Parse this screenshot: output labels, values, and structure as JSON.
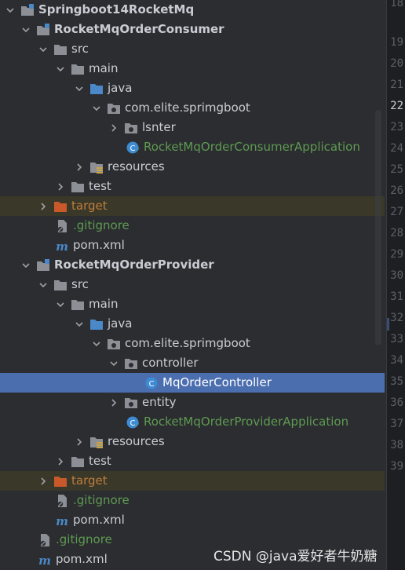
{
  "tree": {
    "items": [
      {
        "label": "Springboot14RocketMq"
      },
      {
        "label": "RocketMqOrderConsumer"
      },
      {
        "label": "src"
      },
      {
        "label": "main"
      },
      {
        "label": "java"
      },
      {
        "label": "com.elite.sprimgboot"
      },
      {
        "label": "lsnter"
      },
      {
        "label": "RocketMqOrderConsumerApplication"
      },
      {
        "label": "resources"
      },
      {
        "label": "test"
      },
      {
        "label": "target"
      },
      {
        "label": ".gitignore"
      },
      {
        "label": "pom.xml"
      },
      {
        "label": "RocketMqOrderProvider"
      },
      {
        "label": "src"
      },
      {
        "label": "main"
      },
      {
        "label": "java"
      },
      {
        "label": "com.elite.sprimgboot"
      },
      {
        "label": "controller"
      },
      {
        "label": "MqOrderController"
      },
      {
        "label": "entity"
      },
      {
        "label": "RocketMqOrderProviderApplication"
      },
      {
        "label": "resources"
      },
      {
        "label": "test"
      },
      {
        "label": "target"
      },
      {
        "label": ".gitignore"
      },
      {
        "label": "pom.xml"
      },
      {
        "label": ".gitignore"
      },
      {
        "label": "pom.xml"
      }
    ]
  },
  "gutter": {
    "lines": [
      "18",
      "19",
      "20",
      "21",
      "22",
      "23",
      "24",
      "25",
      "26",
      "27",
      "28",
      "29",
      "30",
      "31",
      "32",
      "33",
      "34",
      "35",
      "36",
      "37",
      "38",
      "39"
    ],
    "active_line": "22"
  },
  "watermark": "CSDN @java爱好者牛奶糖",
  "colors": {
    "background": "#2b2d30",
    "selection": "#4b6eaf",
    "excluded_row": "#3a3829",
    "folder": "#8c9096",
    "source_folder": "#4a88c7",
    "spring_green": "#5f9a52",
    "target_orange": "#c07d3a"
  }
}
